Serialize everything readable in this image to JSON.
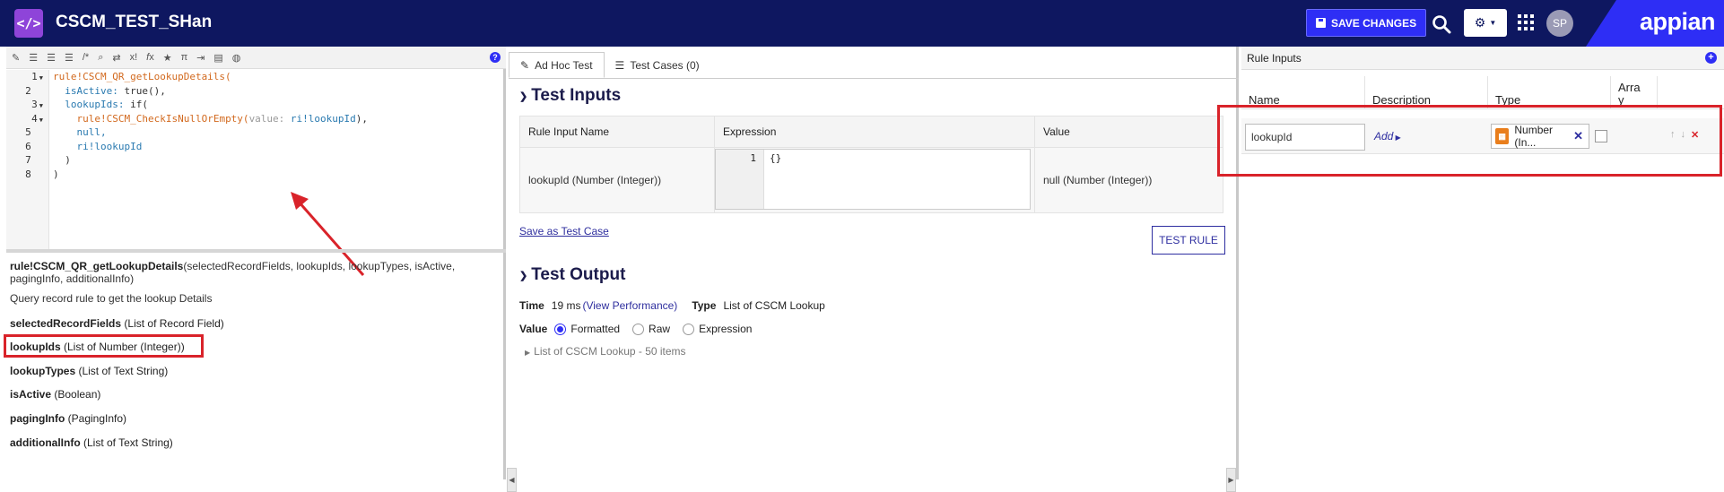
{
  "header": {
    "app_title": "CSCM_TEST_SHan",
    "save_label": "SAVE CHANGES",
    "avatar_initials": "SP",
    "brand": "appian",
    "nav_color": "#0e1760",
    "accent_color": "#2e2ef5"
  },
  "editor": {
    "toolbar_icons": [
      "format-icon",
      "indent-icon",
      "outdent-icon",
      "list-icon",
      "comment-icon",
      "search-icon",
      "replace-icon",
      "function-icon",
      "favorite-icon",
      "constant-icon",
      "rule-icon",
      "record-icon",
      "help-icon"
    ],
    "line_numbers": [
      "1",
      "2",
      "3",
      "4",
      "5",
      "6",
      "7",
      "8"
    ],
    "code": {
      "l1": "rule!CSCM_QR_getLookupDetails(",
      "l2_key": "isActive:",
      "l2_val": " true(),",
      "l3_key": "lookupIds:",
      "l3_val": " if(",
      "l4_fn": "rule!CSCM_CheckIsNullOrEmpty(",
      "l4_key": "value:",
      "l4_val": " ri!lookupId",
      "l4_end": "),",
      "l5": "null,",
      "l6": "ri!lookupId",
      "l7": ")",
      "l8": ")"
    }
  },
  "doc": {
    "signature_name": "rule!CSCM_QR_getLookupDetails",
    "signature_params": "(selectedRecordFields, lookupIds, lookupTypes, isActive, pagingInfo, additionalInfo)",
    "description": "Query record rule to get the lookup Details",
    "params": [
      {
        "name": "selectedRecordFields",
        "type": " (List of Record Field)"
      },
      {
        "name": "lookupIds",
        "type": " (List of Number (Integer))"
      },
      {
        "name": "lookupTypes",
        "type": " (List of Text String)"
      },
      {
        "name": "isActive",
        "type": " (Boolean)"
      },
      {
        "name": "pagingInfo",
        "type": " (PagingInfo)"
      },
      {
        "name": "additionalInfo",
        "type": " (List of Text String)"
      }
    ]
  },
  "middle": {
    "tabs": [
      {
        "label": "Ad Hoc Test",
        "icon": "edit-icon"
      },
      {
        "label": "Test Cases (0)",
        "icon": "list-icon"
      }
    ],
    "test_inputs_title": "Test Inputs",
    "columns": [
      "Rule Input Name",
      "Expression",
      "Value"
    ],
    "row": {
      "input_name": "lookupId (Number (Integer))",
      "expr_line": "1",
      "expr_value": "{}",
      "value": "null (Number (Integer))"
    },
    "save_case_label": "Save as Test Case",
    "test_rule_label": "TEST RULE",
    "test_output_title": "Test Output",
    "time_label": "Time",
    "time_value": "19 ms",
    "view_perf_label": "(View Performance)",
    "type_label": "Type",
    "type_value": "List of CSCM Lookup",
    "value_label": "Value",
    "radio_options": [
      "Formatted",
      "Raw",
      "Expression"
    ],
    "selected_radio": "Formatted",
    "result_summary": "List of CSCM Lookup - 50 items"
  },
  "rule_inputs": {
    "title": "Rule Inputs",
    "columns": [
      "Name",
      "Description",
      "Type",
      "Arra\ny"
    ],
    "row": {
      "name_value": "lookupId",
      "description_link": "Add",
      "type_label": "Number (In..."
    }
  }
}
